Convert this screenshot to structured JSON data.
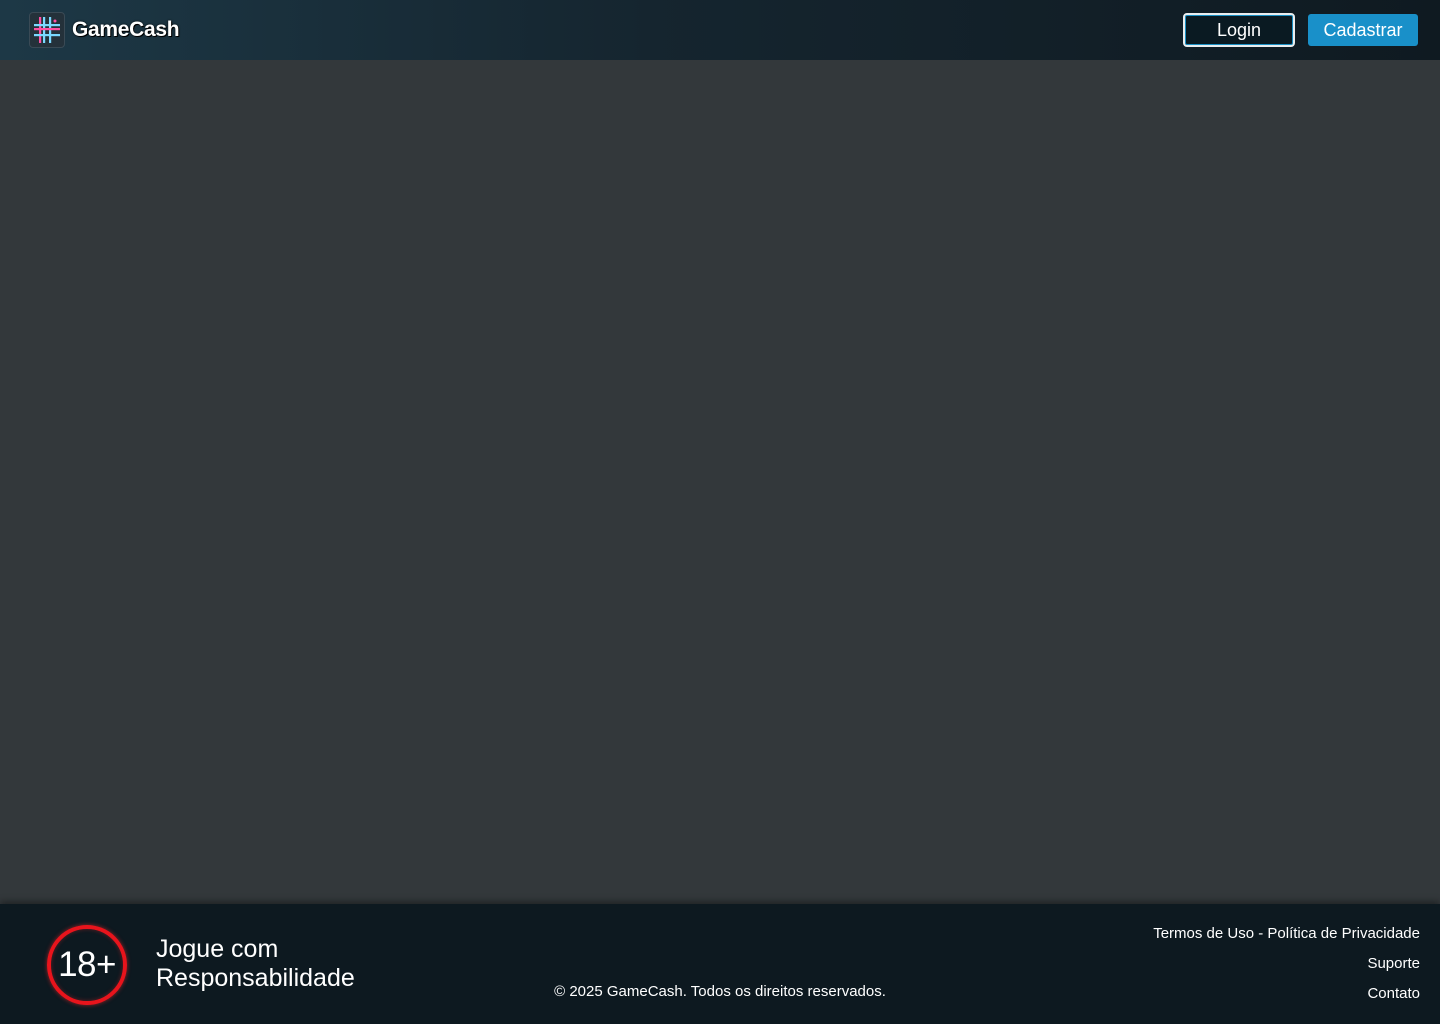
{
  "header": {
    "logo_icon": "grid-hash-logo-icon",
    "brand_name": "GameCash",
    "login_label": "Login",
    "signup_label": "Cadastrar"
  },
  "footer": {
    "age_badge": "18+",
    "responsible_text": "Jogue com Responsabilidade",
    "copyright": "© 2025 GameCash. Todos os direitos reservados.",
    "links": {
      "terms_privacy": "Termos de Uso - Política de Privacidade",
      "support": "Suporte",
      "contact": "Contato"
    }
  },
  "colors": {
    "header_bg": "#1d3846",
    "main_bg": "#33383b",
    "footer_bg": "#0d1920",
    "accent": "#1990c9",
    "age_badge_ring": "#e8141c"
  }
}
